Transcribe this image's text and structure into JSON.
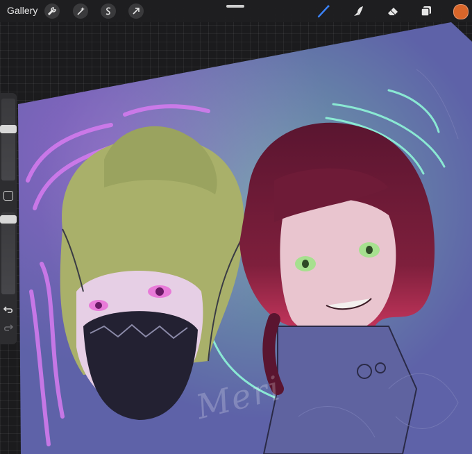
{
  "toolbar": {
    "gallery_label": "Gallery",
    "left_tools": [
      {
        "name": "actions",
        "icon": "wrench-icon"
      },
      {
        "name": "adjustments",
        "icon": "magic-wand-icon"
      },
      {
        "name": "selection",
        "icon": "selection-s-icon"
      },
      {
        "name": "transform",
        "icon": "arrow-cursor-icon"
      }
    ],
    "right_tools": [
      {
        "name": "brush",
        "icon": "brush-icon",
        "active": true,
        "color": "#3b82f6"
      },
      {
        "name": "smudge",
        "icon": "smudge-icon"
      },
      {
        "name": "eraser",
        "icon": "eraser-icon"
      },
      {
        "name": "layers",
        "icon": "layers-icon"
      }
    ],
    "current_color": "#d9662a"
  },
  "sidebar": {
    "brush_size_level": 0.15,
    "opacity_level": 0.05,
    "modify_button_icon": "square-icon",
    "undo_icon": "undo-icon",
    "redo_icon": "redo-icon"
  },
  "canvas": {
    "background_color": "#5e62a8",
    "watermark_text": "Meri"
  }
}
